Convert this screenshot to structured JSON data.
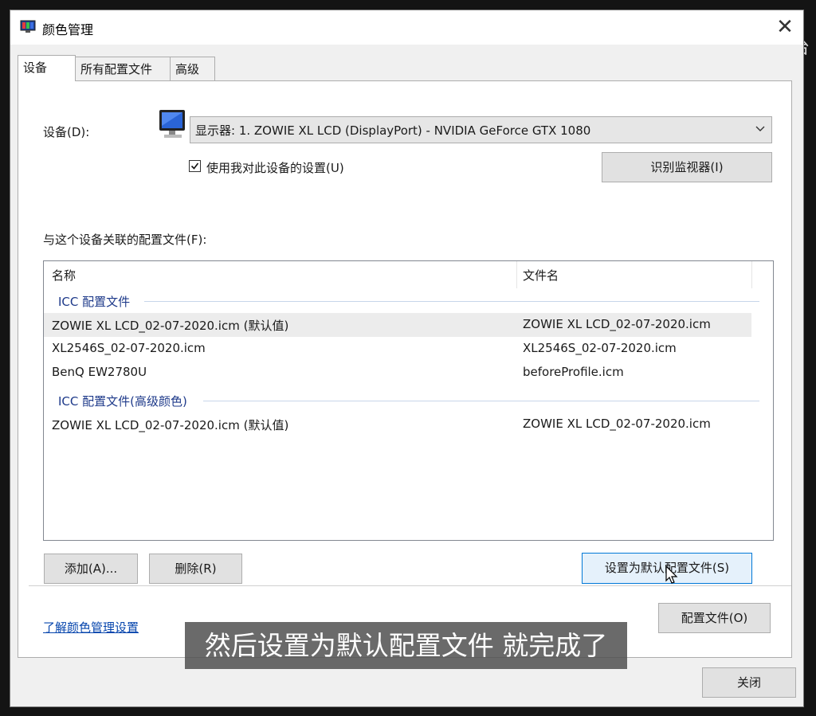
{
  "corner": "风宁台",
  "window": {
    "title": "颜色管理",
    "close_glyph": "✕"
  },
  "tabs": [
    {
      "label": "设备",
      "active": true
    },
    {
      "label": "所有配置文件",
      "active": false
    },
    {
      "label": "高级",
      "active": false
    }
  ],
  "device": {
    "label": "设备(D):",
    "selected": "显示器: 1. ZOWIE XL LCD (DisplayPort) - NVIDIA GeForce GTX 1080",
    "use_settings_label": "使用我对此设备的设置(U)",
    "use_settings_checked": true,
    "identify_button": "识别监视器(I)"
  },
  "profiles": {
    "section_label": "与这个设备关联的配置文件(F):",
    "columns": {
      "name": "名称",
      "file": "文件名"
    },
    "groups": [
      {
        "title": "ICC 配置文件",
        "rows": [
          {
            "name": "ZOWIE XL LCD_02-07-2020.icm (默认值)",
            "file": "ZOWIE XL LCD_02-07-2020.icm",
            "selected": true
          },
          {
            "name": "XL2546S_02-07-2020.icm",
            "file": "XL2546S_02-07-2020.icm",
            "selected": false
          },
          {
            "name": "BenQ EW2780U",
            "file": "beforeProfile.icm",
            "selected": false
          }
        ]
      },
      {
        "title": "ICC 配置文件(高级颜色)",
        "rows": [
          {
            "name": "ZOWIE XL LCD_02-07-2020.icm (默认值)",
            "file": "ZOWIE XL LCD_02-07-2020.icm",
            "selected": false
          }
        ]
      }
    ]
  },
  "buttons": {
    "add": "添加(A)...",
    "remove": "删除(R)",
    "set_default": "设置为默认配置文件(S)",
    "profiles": "配置文件(O)",
    "close": "关闭"
  },
  "link": "了解颜色管理设置",
  "caption": "然后设置为默认配置文件 就完成了",
  "colors": {
    "accent": "#0078d7",
    "link": "#0645ad",
    "group": "#1e3a8a"
  }
}
